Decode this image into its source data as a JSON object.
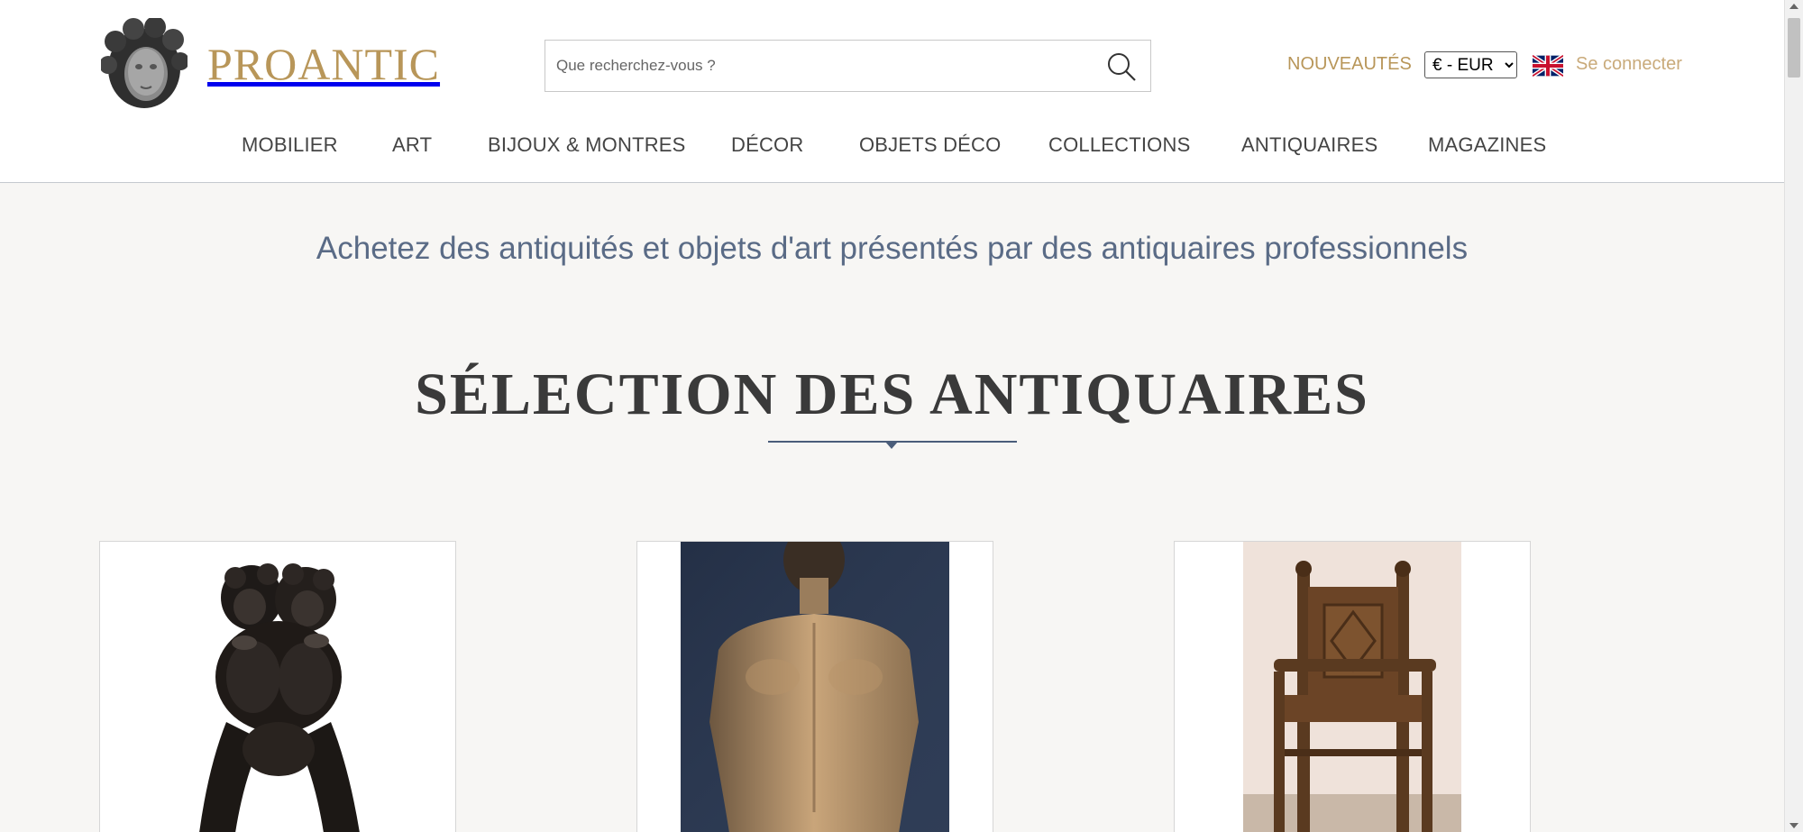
{
  "header": {
    "logo_text": "PROANTIC",
    "search_placeholder": "Que recherchez-vous ?",
    "nouveautes": "NOUVEAUTÉS",
    "currency_selected": "€ - EUR",
    "login": "Se connecter"
  },
  "nav": {
    "items": [
      "MOBILIER",
      "ART",
      "BIJOUX & MONTRES",
      "DÉCOR",
      "OBJETS DÉCO",
      "COLLECTIONS",
      "ANTIQUAIRES",
      "MAGAZINES"
    ]
  },
  "main": {
    "tagline": "Achetez des antiquités et objets d'art présentés par des antiquaires professionnels",
    "section_title": "SÉLECTION DES ANTIQUAIRES"
  },
  "colors": {
    "brand_gold": "#b89659",
    "tagline_blue": "#5a6b86",
    "background": "#f7f6f4"
  }
}
